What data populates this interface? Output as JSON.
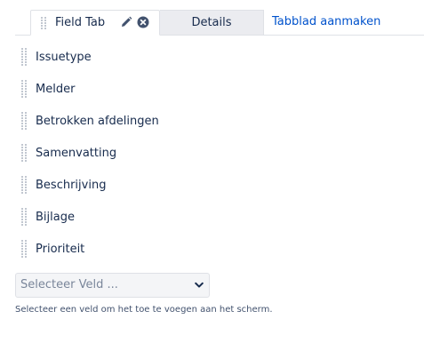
{
  "tabs": {
    "active_label": "Field Tab",
    "inactive_label": "Details",
    "add_tab_label": "Tabblad aanmaken",
    "link_color": "#0052cc",
    "active_icons": [
      "drag-handle-icon",
      "pencil-icon",
      "remove-icon"
    ]
  },
  "fields": [
    {
      "label": "Issuetype"
    },
    {
      "label": "Melder"
    },
    {
      "label": "Betrokken afdelingen"
    },
    {
      "label": "Samenvatting"
    },
    {
      "label": "Beschrijving"
    },
    {
      "label": "Bijlage"
    },
    {
      "label": "Prioriteit"
    }
  ],
  "field_select": {
    "selected_value": "Selecteer Veld ...",
    "icon": "chevron-down-icon"
  },
  "hint_text": "Selecteer een veld om het toe te voegen aan het scherm."
}
